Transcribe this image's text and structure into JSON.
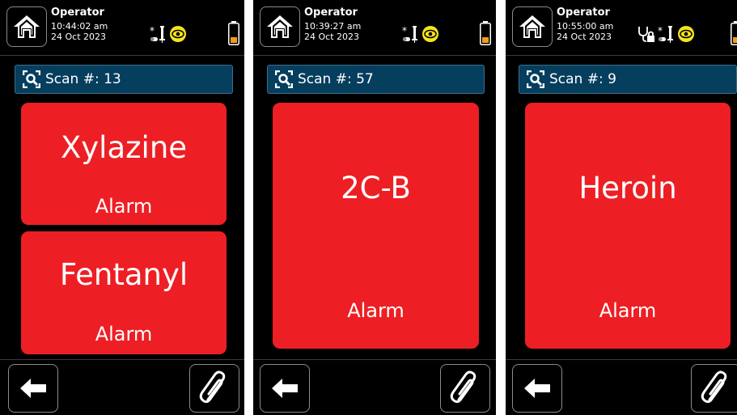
{
  "screens": [
    {
      "operator": "Operator",
      "time": "10:44:02 am",
      "date": "24 Oct 2023",
      "status_icons": [
        "syringe-pill-icon",
        "eye-icon"
      ],
      "battery": "battery-low",
      "scan_label": "Scan #: 13",
      "alarms": [
        {
          "substance": "Xylazine",
          "status": "Alarm"
        },
        {
          "substance": "Fentanyl",
          "status": "Alarm"
        }
      ]
    },
    {
      "operator": "Operator",
      "time": "10:39:27 am",
      "date": "24 Oct 2023",
      "status_icons": [
        "syringe-pill-icon",
        "eye-icon"
      ],
      "battery": "battery-low",
      "scan_label": "Scan #: 57",
      "alarms": [
        {
          "substance": "2C-B",
          "status": "Alarm"
        }
      ]
    },
    {
      "operator": "Operator",
      "time": "10:55:00 am",
      "date": "24 Oct 2023",
      "status_icons": [
        "stethoscope-lock-icon",
        "syringe-pill-icon",
        "eye-icon"
      ],
      "battery": "battery-low",
      "scan_label": "Scan #: 9",
      "alarms": [
        {
          "substance": "Heroin",
          "status": "Alarm"
        }
      ]
    }
  ],
  "colors": {
    "alarm_red": "#ed1f24",
    "scan_bar": "#063e5e",
    "eye_yellow": "#f6e51c",
    "battery_orange": "#f29a1b"
  }
}
